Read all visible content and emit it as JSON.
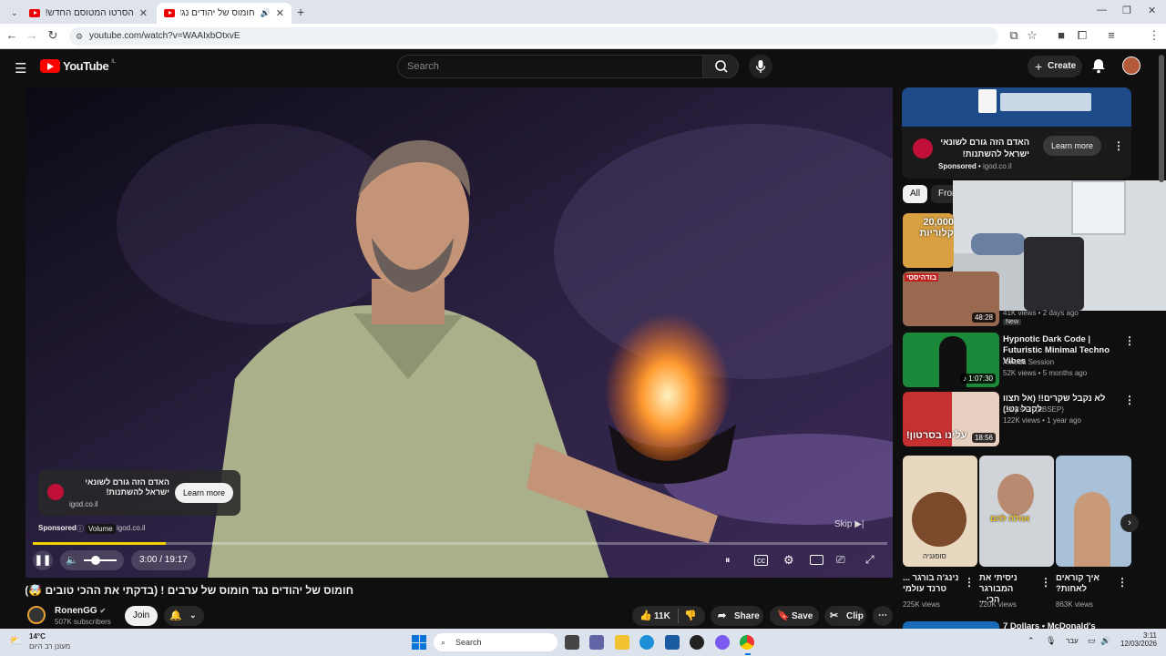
{
  "browser": {
    "tabs": [
      {
        "title": "הסרטו המטוסם החדש! (שיחה)",
        "active": false
      },
      {
        "title": "חומוס של יהודים נגד חומוס",
        "active": true
      }
    ],
    "url": "youtube.com/watch?v=WAAIxbOtxvE"
  },
  "header": {
    "logo_text": "YouTube",
    "region": "IL",
    "search_placeholder": "Search",
    "create_label": "Create"
  },
  "ad_overlay": {
    "title": "האדם הזה גורם לשונאי ישראל להשתנות!",
    "domain": "igod.co.il",
    "cta": "Learn more",
    "sponsored": "Sponsored",
    "sponsored_domain": "igod.co.il",
    "tooltip": "Volume"
  },
  "player": {
    "skip_label": "Skip",
    "time": "3:00 / 19:17",
    "progress": 0.156
  },
  "video": {
    "title": "חומוס של יהודים נגד חומוס של ערבים ! (בדקתי את ההכי טובים 🤯)",
    "channel": "RonenGG",
    "subscribers": "507K subscribers",
    "join_label": "Join",
    "likes": "11K",
    "share_label": "Share",
    "save_label": "Save",
    "clip_label": "Clip"
  },
  "sidebar": {
    "ad": {
      "title": "האדם הזה גורם לשונאי ישראל להשתנות!",
      "sponsored": "Sponsored",
      "domain": "igod.co.il",
      "cta": "Learn more"
    },
    "chips": [
      "All",
      "From"
    ],
    "items": [
      {
        "thumb_text": "20,000 קלוריות",
        "duration": "",
        "title": "",
        "channel": "",
        "meta": ""
      },
      {
        "thumb_text": "בודהיססי",
        "duration": "48:28",
        "title": "",
        "channel": "",
        "meta": "41K views • 2 days ago",
        "badge": "New"
      },
      {
        "thumb_text": "",
        "duration": "1:07:30",
        "title": "Hypnotic Dark Code | Futuristic Minimal Techno Vibes",
        "channel": "Amoda Session",
        "meta": "52K views • 5 months ago"
      },
      {
        "thumb_text": "עלינו בסרטון!",
        "duration": "18:56",
        "title": "לא נקבל שקרים!! (אל תצוו לקבל גט!)",
        "channel": "Levy's Fit (LBSEP)",
        "meta": "122K views • 1 year ago"
      }
    ],
    "shorts": [
      {
        "thumb_text": "סופגניה",
        "title": "נינג'ה בורגר ... טרנד עולמי",
        "views": "225K views"
      },
      {
        "thumb_text": "אוזלה להם",
        "title": "ניסיתי את המבורגר הכי...",
        "views": "220K views"
      },
      {
        "thumb_text": "",
        "title": "איך קוראים לאחות?",
        "views": "863K views"
      }
    ],
    "next_title": "7 Dollars • McDonald's"
  },
  "taskbar": {
    "weather_temp": "14°C",
    "weather_desc": "מעונן רב היום",
    "search_label": "Search",
    "lang": "עבר",
    "time": "3:11",
    "date": "12/03/2026"
  },
  "colors": {
    "youtube_red": "#ff0000",
    "progress": "#f4d200",
    "background": "#0f0f0f"
  }
}
